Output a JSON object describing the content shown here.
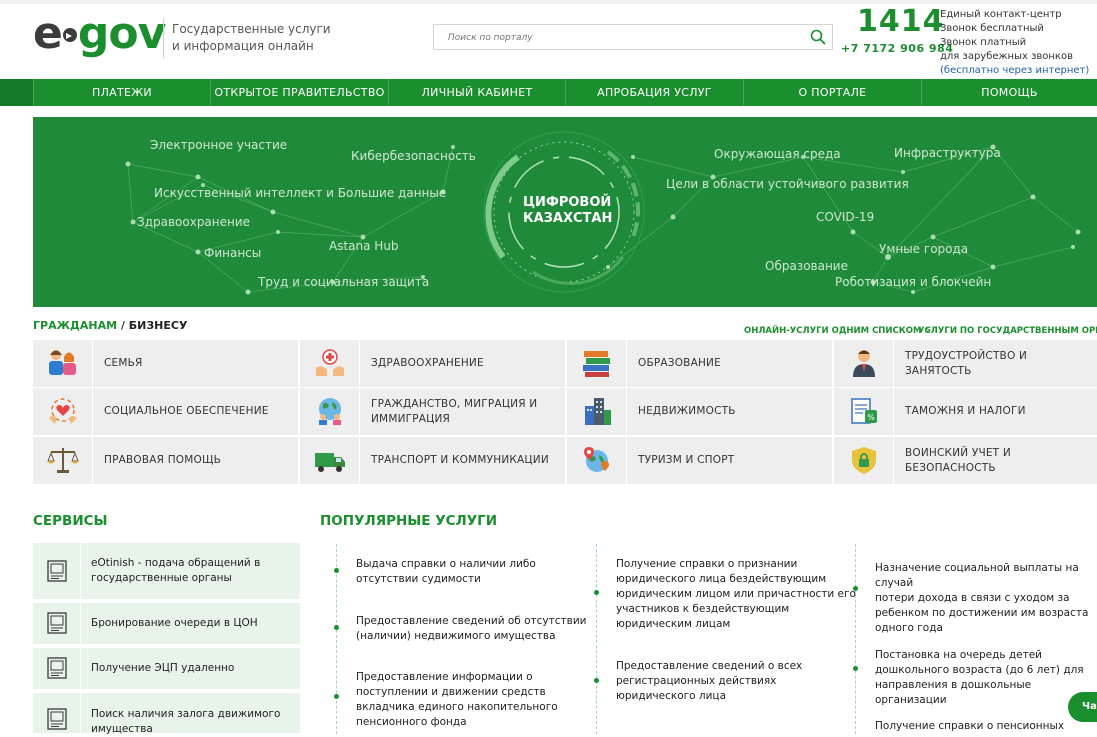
{
  "header": {
    "logo_e": "e",
    "logo_gov": "gov",
    "tagline_line1": "Государственные услуги",
    "tagline_line2": "и информация онлайн",
    "search_placeholder": "Поиск по порталу",
    "phone_short": "1414",
    "phone_long": "+7 7172 906 984",
    "contact_line1": "Единый контакт-центр",
    "contact_line2": "Звонок бесплатный",
    "contact_line3": "Звонок платный",
    "contact_line4": "для зарубежных звонков",
    "contact_line5": "(бесплатно через интернет)"
  },
  "nav": [
    "ПЛАТЕЖИ",
    "ОТКРЫТОЕ ПРАВИТЕЛЬСТВО",
    "ЛИЧНЫЙ КАБИНЕТ",
    "АПРОБАЦИЯ УСЛУГ",
    "О ПОРТАЛЕ",
    "ПОМОЩЬ"
  ],
  "banner": {
    "center_line1": "ЦИФРОВОЙ",
    "center_line2": "КАЗАХСТАН",
    "labels": [
      "Электронное участие",
      "Кибербезопасность",
      "Искусственный интеллект и Большие данные",
      "Здравоохранение",
      "Финансы",
      "Astana Hub",
      "Труд и социальная защита",
      "Окружающая среда",
      "Инфраструктура",
      "Цели в области устойчивого развития",
      "COVID-19",
      "Умные города",
      "Образование",
      "Роботизация и блокчейн"
    ]
  },
  "categories_header": {
    "citizens": "ГРАЖДАНАМ",
    "separator": "/",
    "business": "БИЗНЕСУ",
    "link_list": "ОНЛАЙН-УСЛУГИ ОДНИМ СПИСКОМ >",
    "link_orgs": "УСЛУГИ ПО ГОСУДАРСТВЕННЫМ ОРГАНАМ >"
  },
  "categories": [
    {
      "label": "СЕМЬЯ",
      "icon": "family-icon"
    },
    {
      "label": "ЗДРАВООХРАНЕНИЕ",
      "icon": "healthcare-icon"
    },
    {
      "label": "ОБРАЗОВАНИЕ",
      "icon": "books-icon"
    },
    {
      "label": "ТРУДОУСТРОЙСТВО И ЗАНЯТОСТЬ",
      "icon": "worker-icon"
    },
    {
      "label": "СОЦИАЛЬНОЕ ОБЕСПЕЧЕНИЕ",
      "icon": "heart-hands-icon"
    },
    {
      "label": "ГРАЖДАНСТВО, МИГРАЦИЯ И ИММИГРАЦИЯ",
      "icon": "globe-people-icon"
    },
    {
      "label": "НЕДВИЖИМОСТЬ",
      "icon": "buildings-icon"
    },
    {
      "label": "ТАМОЖНЯ И НАЛОГИ",
      "icon": "tax-document-icon"
    },
    {
      "label": "ПРАВОВАЯ ПОМОЩЬ",
      "icon": "scales-icon"
    },
    {
      "label": "ТРАНСПОРТ И КОММУНИКАЦИИ",
      "icon": "truck-icon"
    },
    {
      "label": "ТУРИЗМ И СПОРТ",
      "icon": "map-pin-icon"
    },
    {
      "label": "ВОИНСКИЙ УЧЕТ И БЕЗОПАСНОСТЬ",
      "icon": "shield-lock-icon"
    }
  ],
  "services": {
    "title": "СЕРВИСЫ",
    "items": [
      {
        "line1": "eOtinish - подача обращений в",
        "line2": "государственные органы"
      },
      {
        "line1": "Бронирование очереди в ЦОН",
        "line2": ""
      },
      {
        "line1": "Получение ЭЦП удаленно",
        "line2": ""
      },
      {
        "line1": "Поиск наличия залога движимого",
        "line2": "имущества"
      }
    ]
  },
  "popular": {
    "title": "ПОПУЛЯРНЫЕ УСЛУГИ",
    "col1": [
      [
        "Выдача справки о наличии либо",
        "отсутствии судимости"
      ],
      [
        "Предоставление сведений об отсутствии",
        "(наличии) недвижимого имущества"
      ],
      [
        "Предоставление информации о",
        "поступлении и движении средств",
        "вкладчика единого накопительного",
        "пенсионного фонда"
      ]
    ],
    "col2": [
      [
        "Получение справки о признании",
        "юридического лица бездействующим",
        "юридическим лицом или причастности его",
        "участников к бездействующим",
        "юридическим лицам"
      ],
      [
        "Предоставление сведений о всех",
        "регистрационных действиях",
        "юридического лица"
      ]
    ],
    "col3": [
      [
        "Назначение социальной выплаты на случай",
        "потери дохода в связи с уходом за",
        "ребенком по достижении им возраста",
        "одного года"
      ],
      [
        "Постановка на очередь детей",
        "дошкольного возраста (до 6 лет) для",
        "направления в дошкольные организации"
      ],
      [
        "Получение справки о пенсионных",
        ""
      ]
    ]
  },
  "chat_label": "Чат",
  "colors": {
    "brand_green": "#1b8f2e",
    "banner_green": "#1f8a3a",
    "tile_gray": "#eeeeee",
    "service_bg": "#e8f4ea"
  }
}
